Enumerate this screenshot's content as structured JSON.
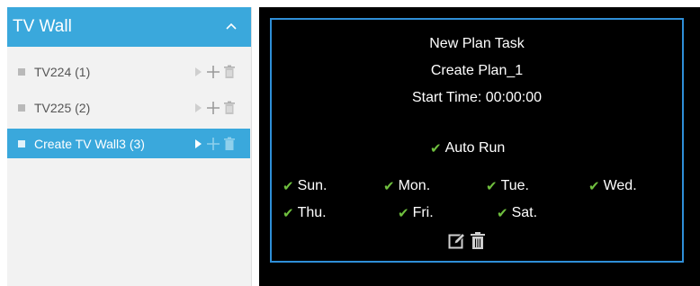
{
  "sidebar": {
    "title": "TV Wall",
    "items": [
      {
        "label": "TV224 (1)"
      },
      {
        "label": "TV225 (2)"
      },
      {
        "label": "Create TV Wall3 (3)"
      }
    ]
  },
  "plan": {
    "title": "New Plan Task",
    "name": "Create Plan_1",
    "start_time": "Start Time: 00:00:00",
    "auto_run": "Auto Run",
    "days": [
      "Sun.",
      "Mon.",
      "Tue.",
      "Wed.",
      "Thu.",
      "Fri.",
      "Sat."
    ]
  },
  "colors": {
    "accent": "#3aa8dc",
    "border_blue": "#2f8fd8",
    "check_green": "#6fbf3e",
    "highlight_red": "#e0262d"
  }
}
